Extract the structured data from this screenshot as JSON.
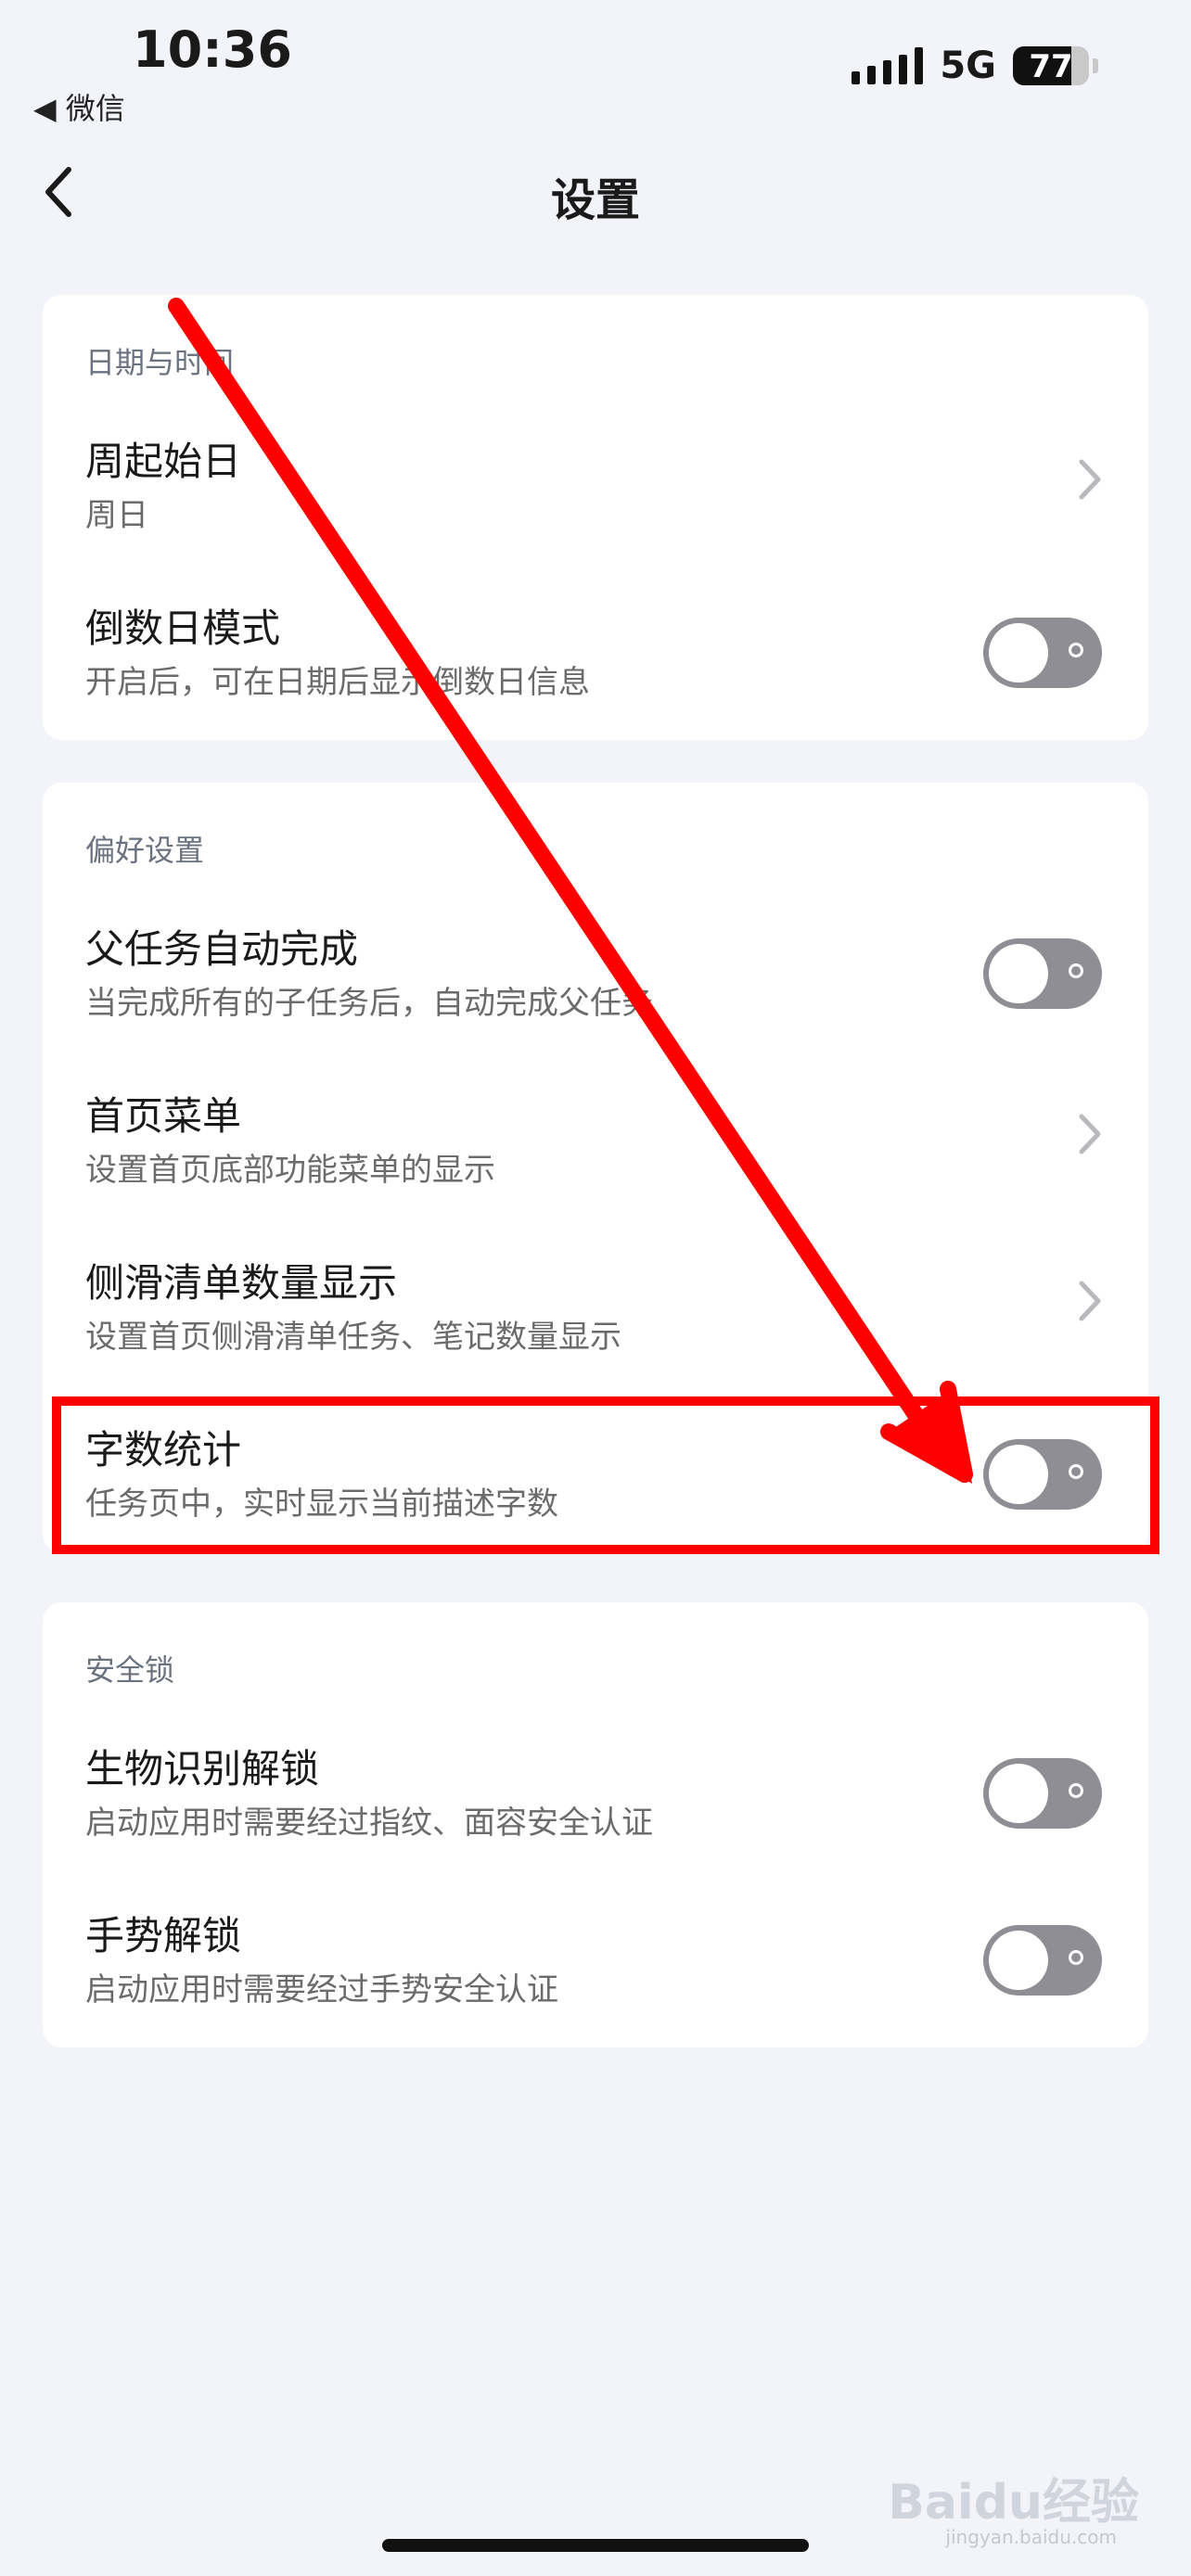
{
  "status_bar": {
    "time": "10:36",
    "back_app": "◀ 微信",
    "network": "5G",
    "battery": "77",
    "battery_percent": 77
  },
  "nav": {
    "title": "设置"
  },
  "sections": [
    {
      "header": "日期与时间",
      "items": [
        {
          "title": "周起始日",
          "subtitle": "周日",
          "control": "chevron"
        },
        {
          "title": "倒数日模式",
          "subtitle": "开启后，可在日期后显示倒数日信息",
          "control": "toggle",
          "on": false
        }
      ]
    },
    {
      "header": "偏好设置",
      "items": [
        {
          "title": "父任务自动完成",
          "subtitle": "当完成所有的子任务后，自动完成父任务",
          "control": "toggle",
          "on": false
        },
        {
          "title": "首页菜单",
          "subtitle": "设置首页底部功能菜单的显示",
          "control": "chevron"
        },
        {
          "title": "侧滑清单数量显示",
          "subtitle": "设置首页侧滑清单任务、笔记数量显示",
          "control": "chevron"
        },
        {
          "title": "字数统计",
          "subtitle": "任务页中，实时显示当前描述字数",
          "control": "toggle",
          "on": false
        }
      ]
    },
    {
      "header": "安全锁",
      "items": [
        {
          "title": "生物识别解锁",
          "subtitle": "启动应用时需要经过指纹、面容安全认证",
          "control": "toggle",
          "on": false
        },
        {
          "title": "手势解锁",
          "subtitle": "启动应用时需要经过手势安全认证",
          "control": "toggle",
          "on": false
        }
      ]
    }
  ],
  "watermark": {
    "text": "Baidu经验",
    "url": "jingyan.baidu.com"
  },
  "colors": {
    "background": "#f2f4f9",
    "card": "#ffffff",
    "toggle_off": "#8e8e94",
    "annotation": "#ff0000"
  }
}
